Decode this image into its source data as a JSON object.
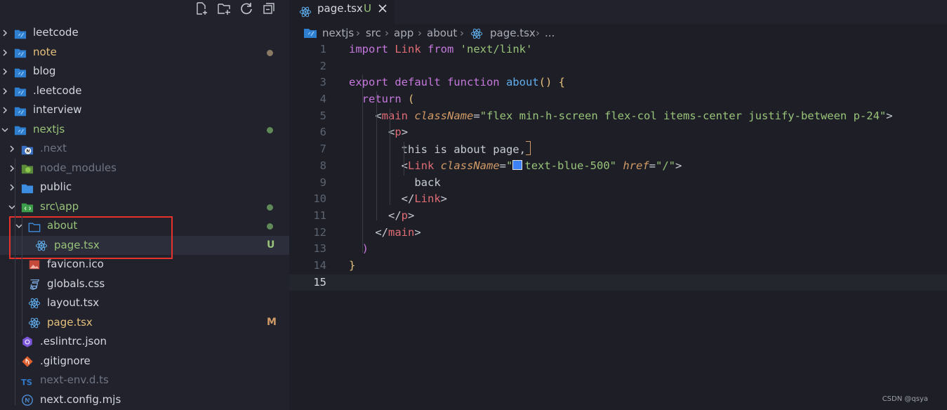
{
  "sidebar": {
    "toolbar": [
      "new-file-icon",
      "new-folder-icon",
      "refresh-icon",
      "collapse-all-icon"
    ],
    "items": [
      {
        "label": "leetcode",
        "color": "white",
        "icon": "folder-vscode-icon",
        "expanded": false,
        "indent": 0,
        "dot": false
      },
      {
        "label": "note",
        "color": "orange",
        "icon": "folder-vscode-icon",
        "expanded": false,
        "indent": 0,
        "dot": "#8a7a64"
      },
      {
        "label": "blog",
        "color": "white",
        "icon": "folder-vscode-icon",
        "expanded": false,
        "indent": 0,
        "dot": false
      },
      {
        "label": ".leetcode",
        "color": "white",
        "icon": "folder-vscode-icon",
        "expanded": false,
        "indent": 0,
        "dot": false
      },
      {
        "label": "interview",
        "color": "white",
        "icon": "folder-vscode-icon",
        "expanded": false,
        "indent": 0,
        "dot": false
      },
      {
        "label": "nextjs",
        "color": "green",
        "icon": "folder-vscode-icon",
        "expanded": true,
        "indent": 0,
        "dot": "#5f8a58"
      },
      {
        "label": ".next",
        "color": "gray",
        "icon": "next-folder-icon",
        "expanded": false,
        "indent": 1,
        "dot": false
      },
      {
        "label": "node_modules",
        "color": "gray",
        "icon": "node-folder-icon",
        "expanded": false,
        "indent": 1,
        "dot": false
      },
      {
        "label": "public",
        "color": "white",
        "icon": "folder-icon",
        "expanded": false,
        "indent": 1,
        "dot": false
      },
      {
        "label": "src\\app",
        "color": "green",
        "icon": "src-folder-icon",
        "expanded": true,
        "indent": 1,
        "dot": "#5f8a58"
      },
      {
        "label": "about",
        "color": "green",
        "icon": "folder-outline-icon",
        "expanded": true,
        "indent": 2,
        "dot": "#5f8a58"
      },
      {
        "label": "page.tsx",
        "color": "green",
        "icon": "react-icon",
        "indent": 3,
        "badge": "U",
        "selected": true
      },
      {
        "label": "favicon.ico",
        "color": "white",
        "icon": "image-icon",
        "indent": 2
      },
      {
        "label": "globals.css",
        "color": "white",
        "icon": "css-icon",
        "indent": 2
      },
      {
        "label": "layout.tsx",
        "color": "white",
        "icon": "react-icon",
        "indent": 2
      },
      {
        "label": "page.tsx",
        "color": "orange",
        "icon": "react-icon",
        "indent": 2,
        "badge": "M"
      },
      {
        "label": ".eslintrc.json",
        "color": "white",
        "icon": "eslint-icon",
        "indent": 1
      },
      {
        "label": ".gitignore",
        "color": "white",
        "icon": "git-icon",
        "indent": 1
      },
      {
        "label": "next-env.d.ts",
        "color": "gray",
        "icon": "typescript-icon",
        "indent": 1
      },
      {
        "label": "next.config.mjs",
        "color": "white",
        "icon": "next-icon",
        "indent": 1
      }
    ]
  },
  "tab": {
    "name": "page.tsx",
    "status": "U"
  },
  "breadcrumb": {
    "items": [
      "nextjs",
      "src",
      "app",
      "about",
      "page.tsx",
      "..."
    ]
  },
  "code": {
    "lines": [
      {
        "n": "1",
        "tokens": [
          [
            "kw",
            "import "
          ],
          [
            "tag",
            "Link "
          ],
          [
            "kw",
            "from "
          ],
          [
            "str",
            "'next/link'"
          ]
        ]
      },
      {
        "n": "2",
        "tokens": []
      },
      {
        "n": "3",
        "tokens": [
          [
            "kw",
            "export default function "
          ],
          [
            "fn",
            "about"
          ],
          [
            "br",
            "() {"
          ]
        ]
      },
      {
        "n": "4",
        "tokens": [
          [
            "pl",
            "  "
          ],
          [
            "kw",
            "return "
          ],
          [
            "br",
            "("
          ]
        ]
      },
      {
        "n": "5",
        "tokens": [
          [
            "pl",
            "    "
          ],
          [
            "pl",
            "<"
          ],
          [
            "tag",
            "main "
          ],
          [
            "attr",
            "className"
          ],
          [
            "pl",
            "="
          ],
          [
            "str",
            "\"flex min-h-screen flex-col items-center justify-between p-24\""
          ],
          [
            "pl",
            ">"
          ]
        ]
      },
      {
        "n": "6",
        "tokens": [
          [
            "pl",
            "      "
          ],
          [
            "pl",
            "<"
          ],
          [
            "tag",
            "p"
          ],
          [
            "pl",
            ">"
          ]
        ]
      },
      {
        "n": "7",
        "tokens": [
          [
            "pl",
            "        this is about page,"
          ]
        ],
        "cursor": true
      },
      {
        "n": "8",
        "tokens": [
          [
            "pl",
            "        <"
          ],
          [
            "tag",
            "Link "
          ],
          [
            "attr",
            "className"
          ],
          [
            "pl",
            "="
          ],
          [
            "str",
            "\""
          ],
          [
            "swatch",
            ""
          ],
          [
            "str",
            "text-blue-500\" "
          ],
          [
            "attr",
            "href"
          ],
          [
            "pl",
            "="
          ],
          [
            "str",
            "\"/\""
          ],
          [
            "pl",
            ">"
          ]
        ]
      },
      {
        "n": "9",
        "tokens": [
          [
            "pl",
            "          back"
          ]
        ]
      },
      {
        "n": "10",
        "tokens": [
          [
            "pl",
            "        </"
          ],
          [
            "tag",
            "Link"
          ],
          [
            "pl",
            ">"
          ]
        ]
      },
      {
        "n": "11",
        "tokens": [
          [
            "pl",
            "      </"
          ],
          [
            "tag",
            "p"
          ],
          [
            "pl",
            ">"
          ]
        ]
      },
      {
        "n": "12",
        "tokens": [
          [
            "pl",
            "    </"
          ],
          [
            "tag",
            "main"
          ],
          [
            "pl",
            ">"
          ]
        ]
      },
      {
        "n": "13",
        "tokens": [
          [
            "pl",
            "  "
          ],
          [
            "kw",
            ")"
          ]
        ]
      },
      {
        "n": "14",
        "tokens": [
          [
            "br",
            "}"
          ]
        ]
      },
      {
        "n": "15",
        "tokens": [],
        "current": true
      }
    ]
  },
  "watermark": "CSDN @qsya",
  "colors": {
    "accent_highlight": "#e5322d",
    "folder_blue": "#3d8ee0",
    "react_blue": "#61afef"
  }
}
